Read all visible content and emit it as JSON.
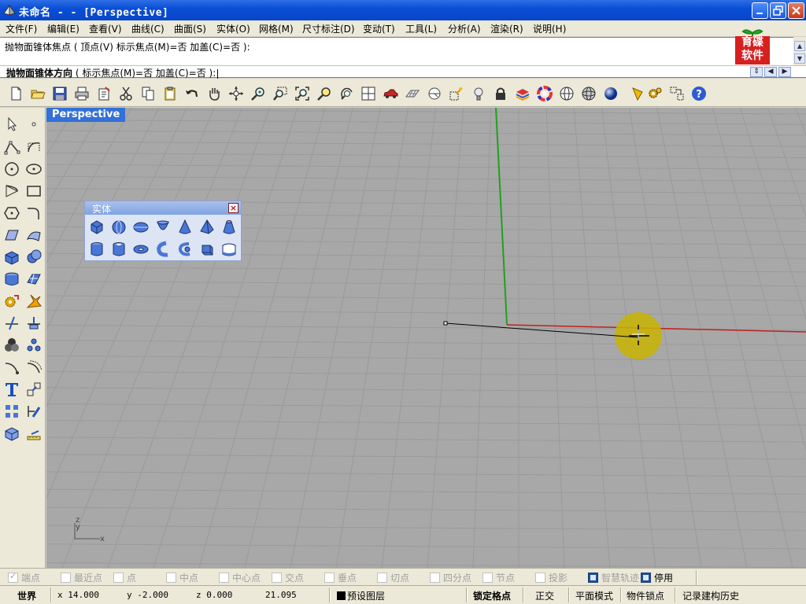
{
  "window": {
    "title": "未命名 -  - [Perspective]",
    "icon": "rhino-app-icon"
  },
  "menu": [
    "文件(F)",
    "编辑(E)",
    "查看(V)",
    "曲线(C)",
    "曲面(S)",
    "实体(O)",
    "网格(M)",
    "尺寸标注(D)",
    "变动(T)",
    "工具(L)",
    "分析(A)",
    "渲染(R)",
    "说明(H)"
  ],
  "command_history": {
    "line": "抛物面锥体焦点 ( 顶点(V)  标示焦点(M)=否  加盖(C)=否 ):"
  },
  "logo": {
    "text_line1": "育碟",
    "text_line2": "软件"
  },
  "command_prompt": {
    "command": "抛物面锥体方向",
    "options": "( 标示焦点(M)=否  加盖(C)=否 ):"
  },
  "viewport": {
    "label": "Perspective",
    "background_color": "#a8a8a8",
    "grid_color": "#9a9a9a",
    "axis_colors": {
      "x": "#c02020",
      "y": "#20a020"
    },
    "axis_widget": {
      "x_label": "x",
      "y_label": "y",
      "z_label": "z"
    }
  },
  "solid_panel": {
    "title": "实体",
    "icons": [
      "box-icon",
      "sphere-icon",
      "ellipsoid-icon",
      "paraboloid-icon",
      "cone-icon",
      "pyramid-icon",
      "truncated-cone-icon",
      "cylinder-icon",
      "tube-icon",
      "torus-icon",
      "pipe-icon",
      "pipe-round-icon",
      "extrude-solid-icon",
      "text-solid-icon"
    ]
  },
  "osnap": [
    {
      "label": "端点",
      "state": "tick"
    },
    {
      "label": "最近点",
      "state": "off"
    },
    {
      "label": "点",
      "state": "off"
    },
    {
      "label": "中点",
      "state": "off"
    },
    {
      "label": "中心点",
      "state": "off"
    },
    {
      "label": "交点",
      "state": "off"
    },
    {
      "label": "垂点",
      "state": "off"
    },
    {
      "label": "切点",
      "state": "off"
    },
    {
      "label": "四分点",
      "state": "off"
    },
    {
      "label": "节点",
      "state": "off"
    },
    {
      "label": "投影",
      "state": "off"
    },
    {
      "label": "智慧轨迹",
      "state": "on-gray"
    },
    {
      "label": "停用",
      "state": "on"
    }
  ],
  "status": {
    "coord_system": "世界",
    "x": "x 14.000",
    "y": "y -2.000",
    "z": "z 0.000",
    "distance": "21.095",
    "layer": "预设图层",
    "modes": [
      "锁定格点",
      "正交",
      "平面模式",
      "物件锁点",
      "记录建构历史"
    ]
  }
}
